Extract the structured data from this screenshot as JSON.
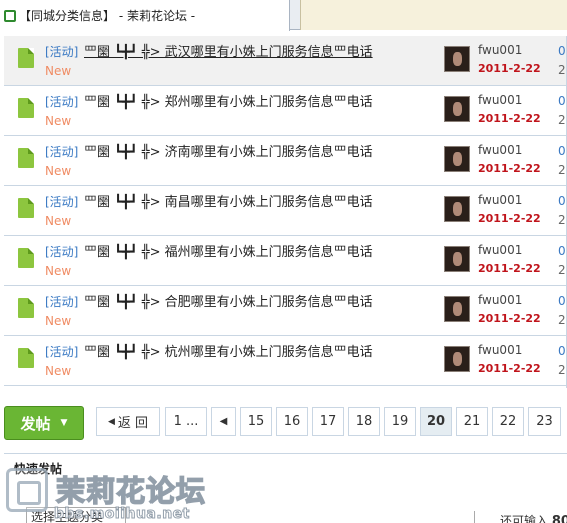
{
  "browser": {
    "tab_title": "【同城分类信息】 - 茉莉花论坛 -"
  },
  "threads": [
    {
      "tag": "[活动]",
      "title": "罒圞 ┗╋┛ ╬> 武汉哪里有小姝上门服务信息罒电话",
      "badge": "New",
      "author": "fwu001",
      "date": "2011-2-22",
      "replies": "0",
      "views": "2"
    },
    {
      "tag": "[活动]",
      "title": "罒圞 ┗╋┛ ╬> 郑州哪里有小姝上门服务信息罒电话",
      "badge": "New",
      "author": "fwu001",
      "date": "2011-2-22",
      "replies": "0",
      "views": "2"
    },
    {
      "tag": "[活动]",
      "title": "罒圞 ┗╋┛ ╬> 济南哪里有小姝上门服务信息罒电话",
      "badge": "New",
      "author": "fwu001",
      "date": "2011-2-22",
      "replies": "0",
      "views": "2"
    },
    {
      "tag": "[活动]",
      "title": "罒圞 ┗╋┛ ╬> 南昌哪里有小姝上门服务信息罒电话",
      "badge": "New",
      "author": "fwu001",
      "date": "2011-2-22",
      "replies": "0",
      "views": "2"
    },
    {
      "tag": "[活动]",
      "title": "罒圞 ┗╋┛ ╬> 福州哪里有小姝上门服务信息罒电话",
      "badge": "New",
      "author": "fwu001",
      "date": "2011-2-22",
      "replies": "0",
      "views": "2"
    },
    {
      "tag": "[活动]",
      "title": "罒圞 ┗╋┛ ╬> 合肥哪里有小姝上门服务信息罒电话",
      "badge": "New",
      "author": "fwu001",
      "date": "2011-2-22",
      "replies": "0",
      "views": "2"
    },
    {
      "tag": "[活动]",
      "title": "罒圞 ┗╋┛ ╬> 杭州哪里有小姝上门服务信息罒电话",
      "badge": "New",
      "author": "fwu001",
      "date": "2011-2-22",
      "replies": "0",
      "views": "2"
    }
  ],
  "icons": {
    "thread": "document-icon",
    "avatar": "user-avatar",
    "back": "triangle-left-icon",
    "dropdown": "caret-down-icon"
  },
  "pager": {
    "post_label": "发帖",
    "back_label": "返 回",
    "first_label": "1 ...",
    "pages": [
      "15",
      "16",
      "17",
      "18",
      "19",
      "20",
      "21",
      "22",
      "23"
    ],
    "current": "20"
  },
  "quick_post": {
    "title": "快速发帖",
    "select_value": "选择主题分类",
    "remaining_label": "还可输入",
    "remaining_value": "80"
  },
  "watermark": {
    "name": "茉莉花论坛",
    "url": "bbs.moiihua.net"
  },
  "colors": {
    "link_blue": "#3a79c3",
    "new_orange": "#f08c64",
    "date_red": "#c0141b",
    "post_green": "#6ab634"
  }
}
